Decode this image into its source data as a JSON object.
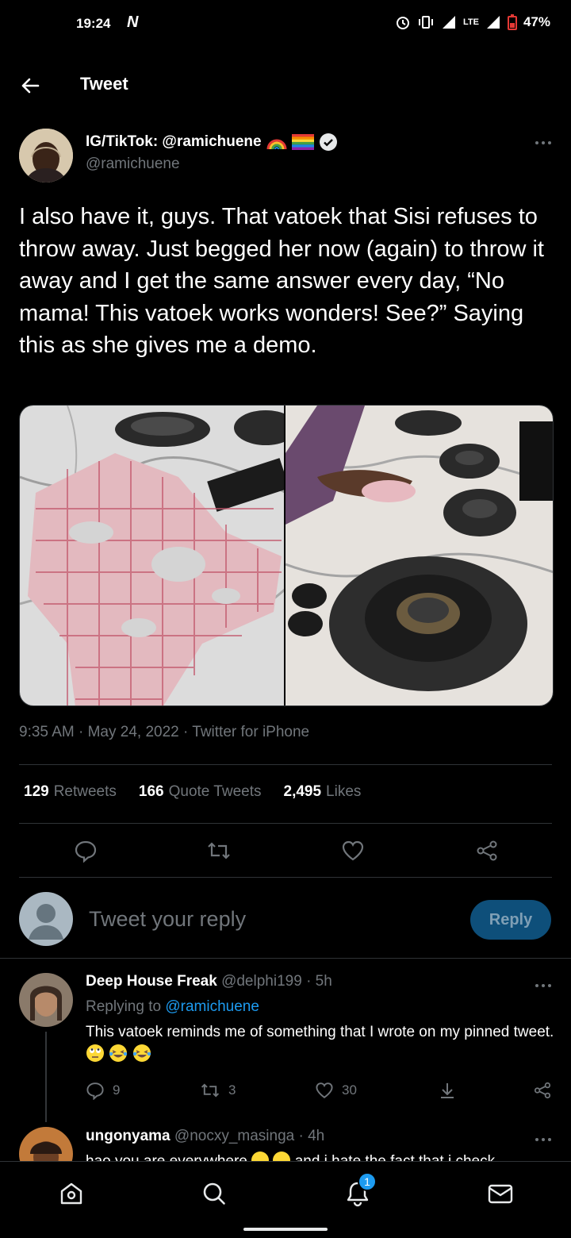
{
  "status_bar": {
    "time": "19:24",
    "carrier_mark": "N",
    "network": "LTE",
    "battery": "47%"
  },
  "header": {
    "title": "Tweet"
  },
  "tweet": {
    "author_name": "IG/TikTok: @ramichuene",
    "author_handle": "@ramichuene",
    "text": "I also have it, guys. That vatoek that Sisi refuses to throw away. Just begged her now (again) to throw it away and I get the same answer every day, “No mama! This vatoek works wonders! See?” Saying this as she gives me a demo.",
    "timestamp": "9:35 AM · May 24, 2022 · Twitter for iPhone",
    "stats": {
      "retweets_count": "129",
      "retweets_label": "Retweets",
      "quotes_count": "166",
      "quotes_label": "Quote Tweets",
      "likes_count": "2,495",
      "likes_label": "Likes"
    }
  },
  "composer": {
    "placeholder": "Tweet your reply",
    "reply_label": "Reply"
  },
  "replies": [
    {
      "name": "Deep House Freak",
      "handle": "@delphi199",
      "time": "· 5h",
      "replying_label": "Replying to",
      "replying_to": "@ramichuene",
      "text": "This vatoek reminds me of something that I wrote on my pinned tweet.",
      "replies_count": "9",
      "retweets_count": "3",
      "likes_count": "30"
    },
    {
      "name": "ungonyama",
      "handle": "@nocxy_masinga",
      "time": "· 4h",
      "text_partial": "hao you are everywhere",
      "text_partial_2": "and i hate the fact that i check"
    }
  ],
  "nav": {
    "notifications_badge": "1"
  },
  "colors": {
    "accent": "#1d9bf0",
    "background": "#000000",
    "muted": "#71767b",
    "verified": "#e7e9ea"
  },
  "icons": [
    "back-arrow-icon",
    "verified-badge-icon",
    "more-icon",
    "comment-icon",
    "retweet-icon",
    "like-icon",
    "share-icon",
    "home-icon",
    "search-icon",
    "notifications-icon",
    "messages-icon"
  ]
}
